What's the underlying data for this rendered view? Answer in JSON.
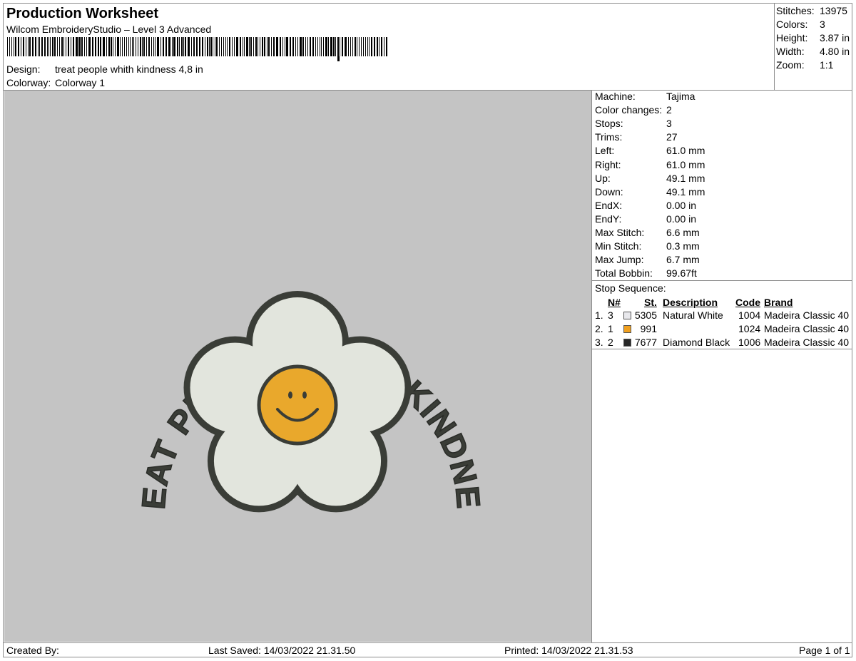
{
  "header": {
    "title": "Production Worksheet",
    "software": "Wilcom EmbroideryStudio – Level 3 Advanced",
    "design_label": "Design:",
    "design_value": "treat people whith kindness 4,8 in",
    "colorway_label": "Colorway:",
    "colorway_value": "Colorway 1"
  },
  "summary": {
    "stitches_label": "Stitches:",
    "stitches_value": "13975",
    "colors_label": "Colors:",
    "colors_value": "3",
    "height_label": "Height:",
    "height_value": "3.87 in",
    "width_label": "Width:",
    "width_value": "4.80 in",
    "zoom_label": "Zoom:",
    "zoom_value": "1:1"
  },
  "machine_info": [
    {
      "label": "Machine:",
      "value": "Tajima"
    },
    {
      "label": "Color changes:",
      "value": "2"
    },
    {
      "label": "Stops:",
      "value": "3"
    },
    {
      "label": "Trims:",
      "value": "27"
    },
    {
      "label": "Left:",
      "value": "61.0 mm"
    },
    {
      "label": "Right:",
      "value": "61.0 mm"
    },
    {
      "label": "Up:",
      "value": "49.1 mm"
    },
    {
      "label": "Down:",
      "value": "49.1 mm"
    },
    {
      "label": "EndX:",
      "value": "0.00 in"
    },
    {
      "label": "EndY:",
      "value": "0.00 in"
    },
    {
      "label": "Max Stitch:",
      "value": "6.6 mm"
    },
    {
      "label": "Min Stitch:",
      "value": "0.3 mm"
    },
    {
      "label": "Max Jump:",
      "value": "6.7 mm"
    },
    {
      "label": "Total Bobbin:",
      "value": "99.67ft"
    }
  ],
  "stop_sequence": {
    "title": "Stop Sequence:",
    "headers": {
      "n": "N#",
      "st": "St.",
      "description": "Description",
      "code": "Code",
      "brand": "Brand"
    },
    "rows": [
      {
        "index": "1.",
        "n": "3",
        "color": "#e8e8ec",
        "st": "5305",
        "description": "Natural White",
        "code": "1004",
        "brand": "Madeira Classic 40"
      },
      {
        "index": "2.",
        "n": "1",
        "color": "#f0a020",
        "st": "991",
        "description": "",
        "code": "1024",
        "brand": "Madeira Classic 40"
      },
      {
        "index": "3.",
        "n": "2",
        "color": "#262626",
        "st": "7677",
        "description": "Diamond Black",
        "code": "1006",
        "brand": "Madeira Classic 40"
      }
    ]
  },
  "design": {
    "text": "TREAT PEOPLE WITH KINDNESS",
    "background_color": "#c4c4c4",
    "outline_color": "#3a3d37",
    "petal_color": "#e2e5dd",
    "face_color": "#e9a82c"
  },
  "footer": {
    "created_by": "Created By:",
    "last_saved": "Last Saved: 14/03/2022 21.31.50",
    "printed": "Printed: 14/03/2022 21.31.53",
    "page": "Page 1 of 1"
  }
}
